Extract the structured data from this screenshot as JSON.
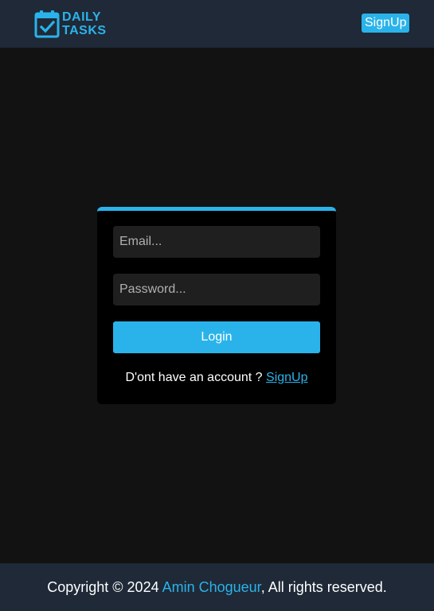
{
  "colors": {
    "accent": "#2ab3ea",
    "header_bg": "#1f2937",
    "page_bg": "#121212",
    "card_bg": "#000000",
    "input_bg": "#1f1f1f"
  },
  "header": {
    "logo": {
      "line1": "DAILY",
      "line2": "TASKS",
      "icon": "calendar-check-icon"
    },
    "signup_label": "SignUp"
  },
  "login_form": {
    "email_placeholder": "Email...",
    "password_placeholder": "Password...",
    "login_label": "Login",
    "prompt_text": "D'ont have an account ? ",
    "signup_link": "SignUp"
  },
  "footer": {
    "prefix": "Copyright © 2024 ",
    "author": "Amin Chogueur",
    "suffix": ", All rights reserved."
  }
}
